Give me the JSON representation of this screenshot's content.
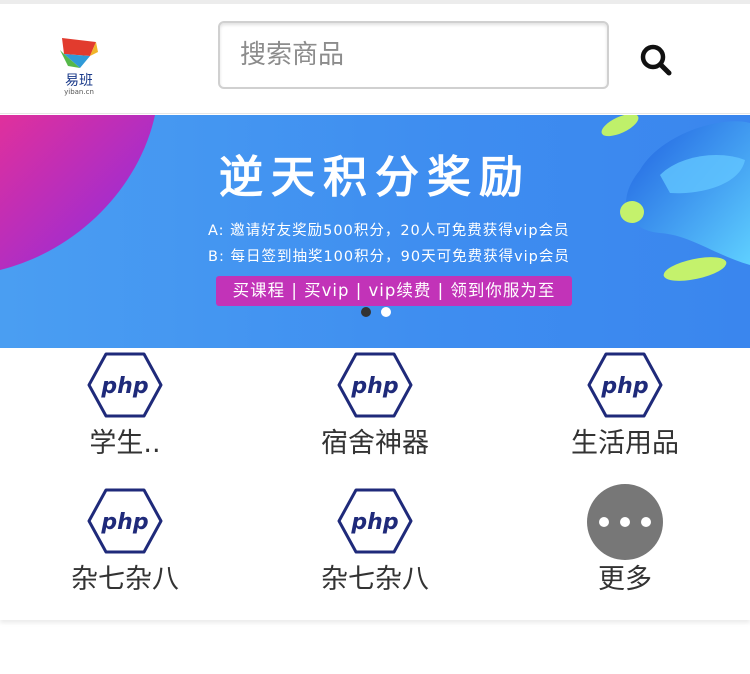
{
  "header": {
    "logo_text": "易班",
    "logo_sub": "yiban.cn",
    "search_placeholder": "搜索商品",
    "search_icon": "search-icon"
  },
  "banner": {
    "title": "逆天积分奖励",
    "line_a": "A: 邀请好友奖励500积分，20人可免费获得vip会员",
    "line_b": "B: 每日签到抽奖100积分，90天可免费获得vip会员",
    "pill": "买课程 | 买vip | vip续费 | 领到你服为至",
    "active_slide": 1,
    "slide_count": 2
  },
  "categories": [
    {
      "label": "学生..",
      "icon": "php-hexagon-icon"
    },
    {
      "label": "宿舍神器",
      "icon": "php-hexagon-icon"
    },
    {
      "label": "生活用品",
      "icon": "php-hexagon-icon"
    },
    {
      "label": "杂七杂八",
      "icon": "php-hexagon-icon"
    },
    {
      "label": "杂七杂八",
      "icon": "php-hexagon-icon"
    },
    {
      "label": "更多",
      "icon": "more-dots-icon"
    }
  ],
  "icon_text": "php",
  "colors": {
    "banner_blue": "#3e8df0",
    "pill_magenta": "#c233b8",
    "php_navy": "#1f2a7a",
    "more_gray": "#777777"
  }
}
